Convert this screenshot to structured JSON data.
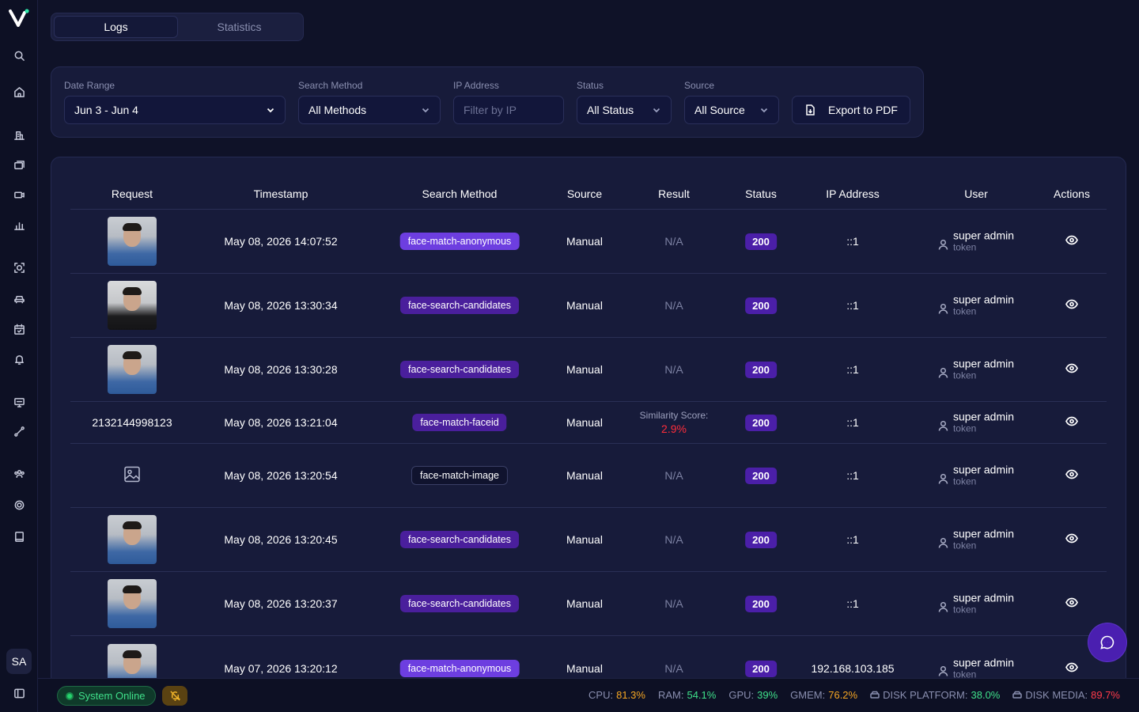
{
  "tabs": [
    {
      "label": "Logs",
      "active": true
    },
    {
      "label": "Statistics",
      "active": false
    }
  ],
  "filters": {
    "date_range": {
      "label": "Date Range",
      "value": "Jun 3 - Jun 4"
    },
    "search_method": {
      "label": "Search Method",
      "value": "All Methods"
    },
    "ip_address": {
      "label": "IP Address",
      "placeholder": "Filter by IP",
      "value": ""
    },
    "status": {
      "label": "Status",
      "value": "All Status"
    },
    "source": {
      "label": "Source",
      "value": "All Source"
    },
    "export_label": "Export to PDF"
  },
  "table": {
    "headers": [
      "Request",
      "Timestamp",
      "Search Method",
      "Source",
      "Result",
      "Status",
      "IP Address",
      "User",
      "Actions"
    ],
    "rows": [
      {
        "request": "photo",
        "timestamp": "May 08, 2026 14:07:52",
        "method": "face-match-anonymous",
        "source": "Manual",
        "result": "N/A",
        "status": "200",
        "ip": "::1",
        "user": "super admin",
        "role": "token"
      },
      {
        "request": "photo",
        "timestamp": "May 08, 2026 13:30:34",
        "method": "face-search-candidates",
        "source": "Manual",
        "result": "N/A",
        "status": "200",
        "ip": "::1",
        "user": "super admin",
        "role": "token"
      },
      {
        "request": "photo",
        "timestamp": "May 08, 2026 13:30:28",
        "method": "face-search-candidates",
        "source": "Manual",
        "result": "N/A",
        "status": "200",
        "ip": "::1",
        "user": "super admin",
        "role": "token"
      },
      {
        "request": "2132144998123",
        "timestamp": "May 08, 2026 13:21:04",
        "method": "face-match-faceid",
        "source": "Manual",
        "result_label": "Similarity Score:",
        "result_value": "2.9%",
        "status": "200",
        "ip": "::1",
        "user": "super admin",
        "role": "token"
      },
      {
        "request": "image-icon",
        "timestamp": "May 08, 2026 13:20:54",
        "method": "face-match-image",
        "source": "Manual",
        "result": "N/A",
        "status": "200",
        "ip": "::1",
        "user": "super admin",
        "role": "token"
      },
      {
        "request": "photo",
        "timestamp": "May 08, 2026 13:20:45",
        "method": "face-search-candidates",
        "source": "Manual",
        "result": "N/A",
        "status": "200",
        "ip": "::1",
        "user": "super admin",
        "role": "token"
      },
      {
        "request": "photo",
        "timestamp": "May 08, 2026 13:20:37",
        "method": "face-search-candidates",
        "source": "Manual",
        "result": "N/A",
        "status": "200",
        "ip": "::1",
        "user": "super admin",
        "role": "token"
      },
      {
        "request": "photo",
        "timestamp": "May 07, 2026 13:20:12",
        "method": "face-match-anonymous",
        "source": "Manual",
        "result": "N/A",
        "status": "200",
        "ip": "192.168.103.185",
        "user": "super admin",
        "role": "token"
      }
    ]
  },
  "sidebar": {
    "avatar": "SA"
  },
  "footer": {
    "system_status": "System Online",
    "metrics": [
      {
        "label": "CPU:",
        "value": "81.3%",
        "color": "#f5a623"
      },
      {
        "label": "RAM:",
        "value": "54.1%",
        "color": "#3fe08a"
      },
      {
        "label": "GPU:",
        "value": "39%",
        "color": "#3fe08a"
      },
      {
        "label": "GMEM:",
        "value": "76.2%",
        "color": "#f5a623"
      },
      {
        "label": "DISK PLATFORM:",
        "value": "38.0%",
        "color": "#3fe08a"
      },
      {
        "label": "DISK MEDIA:",
        "value": "89.7%",
        "color": "#ff3b4a"
      }
    ]
  },
  "colors": {
    "pill_violet": "#6d3ee0",
    "pill_purple": "#4a1f9c",
    "status": "#4b1fa8",
    "background": "#0f1228"
  }
}
